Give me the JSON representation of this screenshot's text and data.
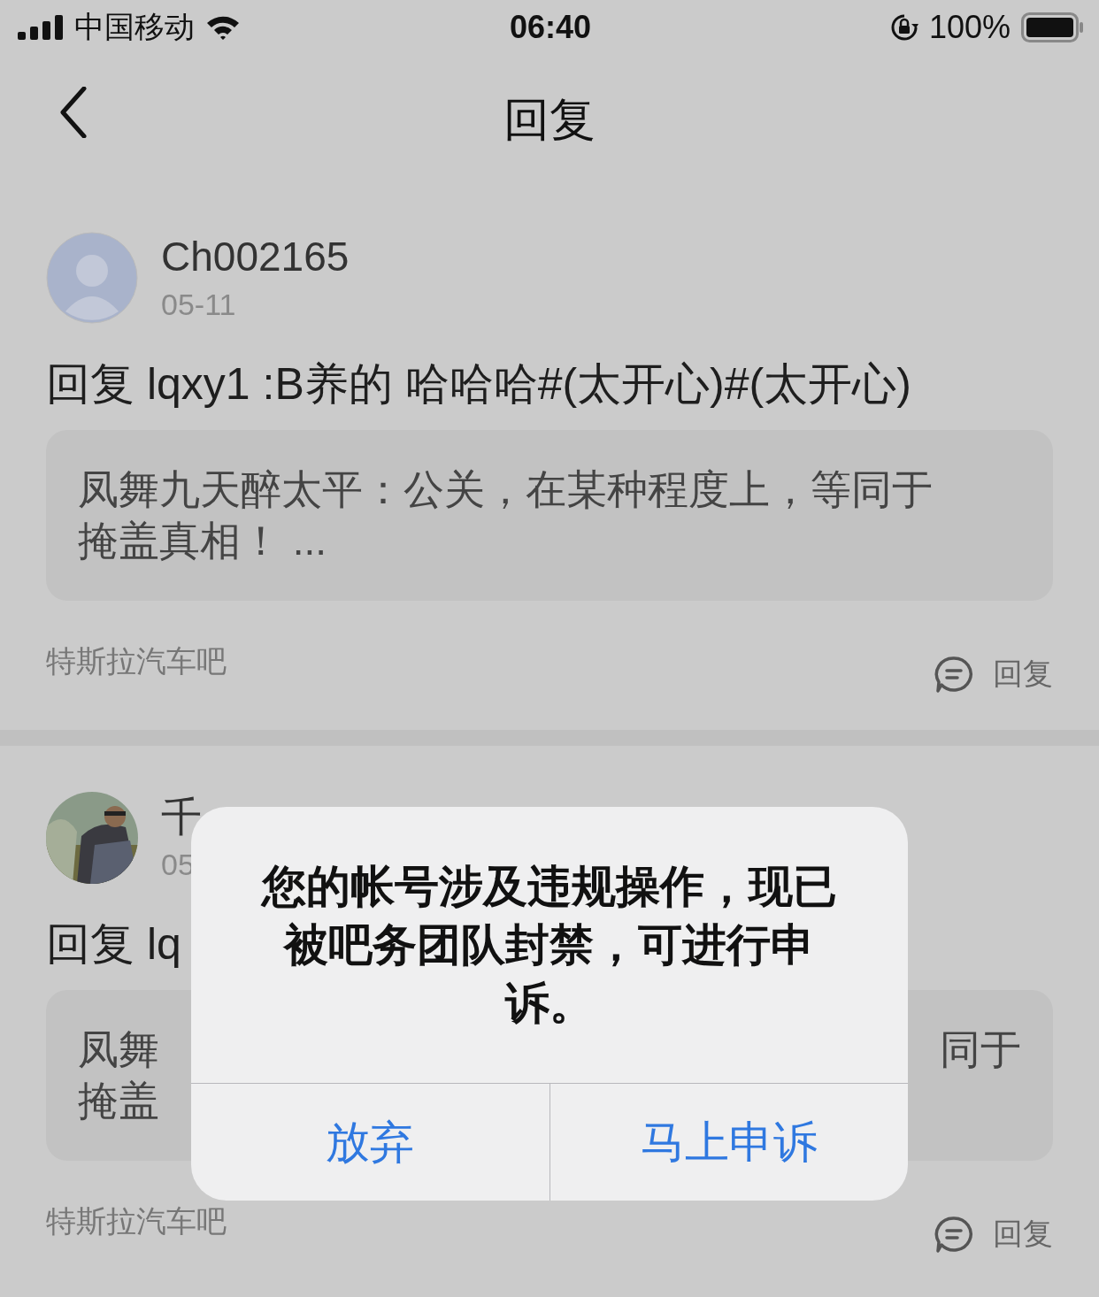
{
  "status_bar": {
    "carrier": "中国移动",
    "time": "06:40",
    "battery": "100%"
  },
  "nav": {
    "title": "回复"
  },
  "posts": [
    {
      "author": "Ch002165",
      "date": "05-11",
      "avatar": {
        "kind": "silhouette"
      },
      "text": "回复 lqxy1 :B养的 哈哈哈#(太开心)#(太开心)",
      "quote_lines": [
        "凤舞九天醉太平：公关，在某种程度上，等同于",
        "掩盖真相！ ..."
      ],
      "forum": "特斯拉汽车吧",
      "reply": "回复"
    },
    {
      "author": "千",
      "date": "05",
      "text": "回复 lq",
      "quote_lines": [
        "凤舞",
        "掩盖"
      ],
      "quote_right": "同于",
      "forum": "特斯拉汽车吧",
      "reply": "回复"
    }
  ],
  "dialog": {
    "message": "您的帐号涉及违规操作，现已被吧务团队封禁，可进行申诉。",
    "buttons": [
      "放弃",
      "马上申诉"
    ]
  }
}
